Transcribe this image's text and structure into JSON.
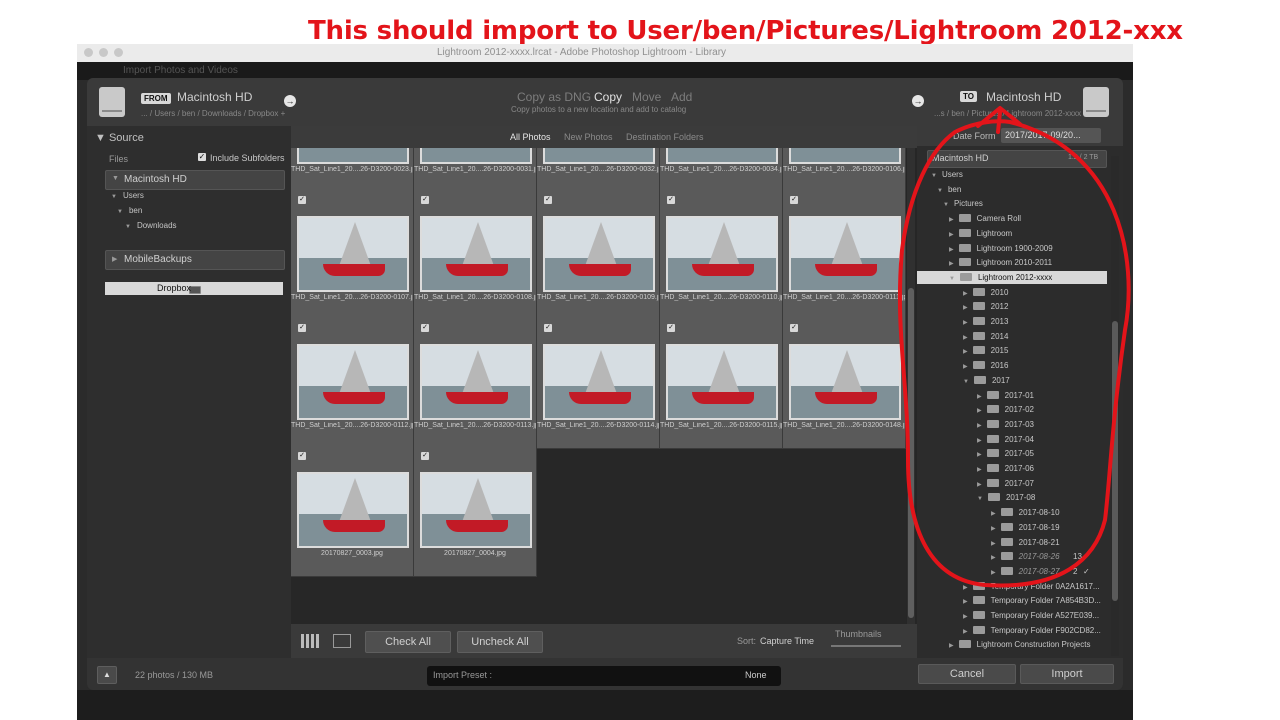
{
  "annotation": "This should import to User/ben/Pictures/Lightroom 2012-xxx",
  "window": {
    "title": "Lightroom 2012-xxxx.lrcat - Adobe Photoshop Lightroom - Library",
    "behind_title": "Import Photos and Videos"
  },
  "header": {
    "from_badge": "FROM",
    "from_volume": "Macintosh HD",
    "from_path": "... / Users / ben / Downloads / Dropbox +",
    "modes": [
      "Copy as DNG",
      "Copy",
      "Move",
      "Add"
    ],
    "active_mode": "Copy",
    "mode_hint": "Copy photos to a new location and add to catalog",
    "to_badge": "TO",
    "to_volume": "Macintosh HD",
    "to_path": "...s / ben / Pictures / Lightroom 2012-xxxx"
  },
  "source": {
    "title": "Source",
    "files_label": "Files",
    "include_subfolders": "Include Subfolders",
    "volume": "Macintosh HD",
    "tree": [
      "Users",
      "ben",
      "Downloads",
      "Dropbox"
    ],
    "other_volume": "MobileBackups"
  },
  "center": {
    "tabs": [
      "All Photos",
      "New Photos",
      "Destination Folders"
    ],
    "active_tab": "All Photos",
    "photos": [
      "THD_Sat_Line1_20....26-D3200-0023.jpg",
      "THD_Sat_Line1_20....26-D3200-0031.jpg",
      "THD_Sat_Line1_20....26-D3200-0032.jpg",
      "THD_Sat_Line1_20....26-D3200-0034.jpg",
      "THD_Sat_Line1_20....26-D3200-0106.jpg",
      "THD_Sat_Line1_20....26-D3200-0107.jpg",
      "THD_Sat_Line1_20....26-D3200-0108.jpg",
      "THD_Sat_Line1_20....26-D3200-0109.jpg",
      "THD_Sat_Line1_20....26-D3200-0110.jpg",
      "THD_Sat_Line1_20....26-D3200-0111.jpg",
      "THD_Sat_Line1_20....26-D3200-0112.jpg",
      "THD_Sat_Line1_20....26-D3200-0113.jpg",
      "THD_Sat_Line1_20....26-D3200-0114.jpg",
      "THD_Sat_Line1_20....26-D3200-0115.jpg",
      "THD_Sat_Line1_20....26-D3200-0148.jpg",
      "20170827_0003.jpg",
      "20170827_0004.jpg"
    ],
    "check_all": "Check All",
    "uncheck_all": "Uncheck All",
    "sort_label": "Sort:",
    "sort_value": "Capture Time",
    "thumbnails_label": "Thumbnails"
  },
  "destination": {
    "date_format_label": "Date Form",
    "date_format_value": "2017/2017-09/20...",
    "volume": "Macintosh HD",
    "volume_size": "1.2 / 2 TB",
    "folders": [
      "Users",
      "ben",
      "Pictures",
      "Camera Roll",
      "Lightroom",
      "Lightroom 1900-2009",
      "Lightroom 2010-2011",
      "Lightroom 2012-xxxx",
      "2010",
      "2012",
      "2013",
      "2014",
      "2015",
      "2016",
      "2017",
      "2017-01",
      "2017-02",
      "2017-03",
      "2017-04",
      "2017-05",
      "2017-06",
      "2017-07",
      "2017-08",
      "2017-08-10",
      "2017-08-19",
      "2017-08-21",
      "2017-08-26",
      "2017-08-27",
      "Temporary Folder 0A2A1617...",
      "Temporary Folder 7A854B3D...",
      "Temporary Folder A527E039...",
      "Temporary Folder F902CD82...",
      "Lightroom Construction Projects"
    ],
    "new_counts": [
      "13",
      "2"
    ]
  },
  "footer": {
    "summary": "22 photos / 130 MB",
    "preset_label": "Import Preset :",
    "preset_value": "None",
    "cancel": "Cancel",
    "import": "Import"
  },
  "colors": {
    "annotation_red": "#e3141a",
    "selected_row": "#d8d8d8",
    "panel_bg": "#2c2c2c"
  }
}
